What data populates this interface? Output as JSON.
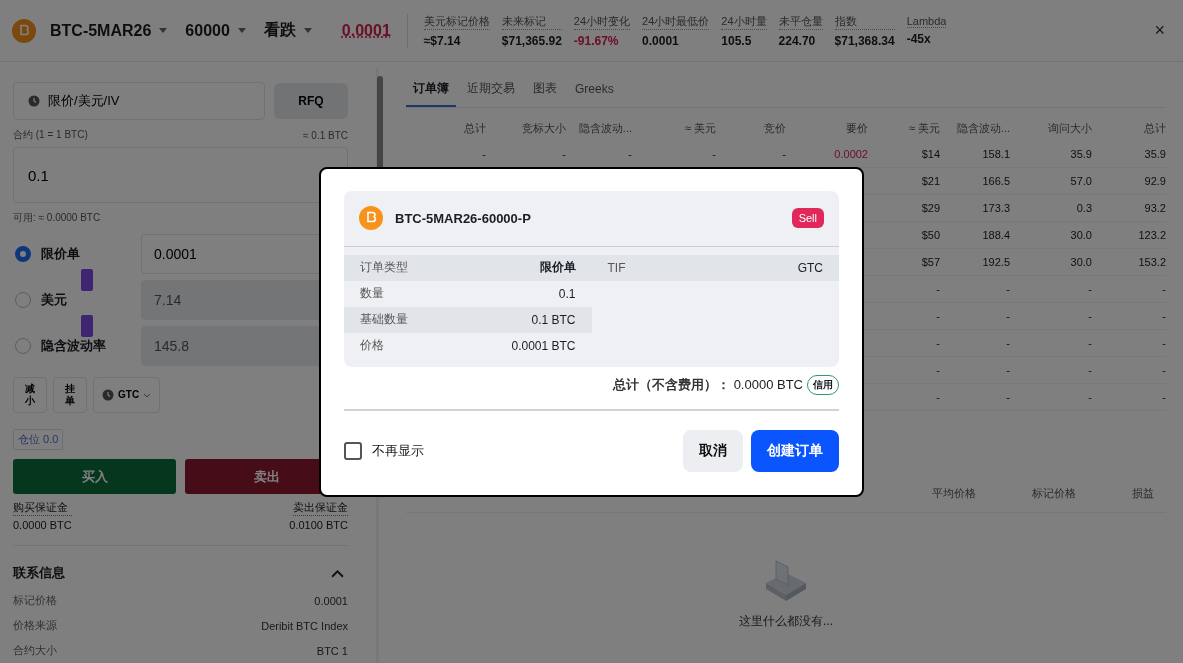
{
  "header": {
    "instrument": "BTC-5MAR26",
    "strike": "60000",
    "option_type": "看跌",
    "price": "0.0001",
    "close": "×",
    "stats": [
      {
        "label": "美元标记价格",
        "value": "≈$7.14",
        "negative": false
      },
      {
        "label": "未来标记",
        "value": "$71,365.92",
        "negative": false
      },
      {
        "label": "24小时变化",
        "value": "-91.67%",
        "negative": true
      },
      {
        "label": "24小时最低价",
        "value": "0.0001",
        "negative": false
      },
      {
        "label": "24小时量",
        "value": "105.5",
        "negative": false
      },
      {
        "label": "未平仓量",
        "value": "224.70",
        "negative": false
      },
      {
        "label": "指数",
        "value": "$71,368.34",
        "negative": false
      },
      {
        "label": "Lambda",
        "value": "-45x",
        "negative": false
      }
    ]
  },
  "order_form": {
    "order_type": "限价/美元/IV",
    "rfq": "RFQ",
    "contract_label": "合约 (1 = 1 BTC)",
    "contract_equiv": "≈ 0.1 BTC",
    "amount": "0.1",
    "available": "可用: ≈ 0.0000 BTC",
    "price_modes": [
      {
        "label": "限价单",
        "value": "0.0001",
        "selected": true,
        "tag": false
      },
      {
        "label": "美元",
        "value": "7.14",
        "selected": false,
        "tag": true
      },
      {
        "label": "隐含波动率",
        "value": "145.8",
        "selected": false,
        "tag": true
      }
    ],
    "options": [
      {
        "kind": "stacked",
        "chars": [
          "减",
          "小"
        ]
      },
      {
        "kind": "stacked",
        "chars": [
          "挂",
          "单"
        ]
      },
      {
        "kind": "select",
        "label": "GTC"
      }
    ],
    "position": "仓位 0.0",
    "buy": "买入",
    "sell": "卖出",
    "margins": [
      {
        "label": "购买保证金",
        "value": "0.0000 BTC"
      },
      {
        "label": "卖出保证金",
        "value": "0.0100 BTC"
      }
    ],
    "info": {
      "title": "联系信息",
      "expanded": true,
      "rows": [
        {
          "label": "标记价格",
          "value": "0.0001"
        },
        {
          "label": "价格来源",
          "value": "Deribit BTC Index"
        },
        {
          "label": "合约大小",
          "value": "BTC 1"
        }
      ]
    }
  },
  "market": {
    "tabs": [
      {
        "label": "订单簿",
        "selected": true
      },
      {
        "label": "近期交易",
        "selected": false
      },
      {
        "label": "图表",
        "selected": false
      },
      {
        "label": "Greeks",
        "selected": false
      }
    ],
    "columns": [
      "总计",
      "竞标大小",
      "隐含波动...",
      "≈ 美元",
      "竞价",
      "要价",
      "≈ 美元",
      "隐含波动...",
      "询问大小",
      "总计"
    ],
    "rows": [
      [
        "-",
        "-",
        "-",
        "-",
        "-",
        "0.0002",
        "$14",
        "158.1",
        "35.9",
        "35.9"
      ],
      [
        null,
        null,
        null,
        null,
        null,
        null,
        "$21",
        "166.5",
        "57.0",
        "92.9"
      ],
      [
        null,
        null,
        null,
        null,
        null,
        null,
        "$29",
        "173.3",
        "0.3",
        "93.2"
      ],
      [
        null,
        null,
        null,
        null,
        null,
        null,
        "$50",
        "188.4",
        "30.0",
        "123.2"
      ],
      [
        null,
        null,
        null,
        null,
        null,
        null,
        "$57",
        "192.5",
        "30.0",
        "153.2"
      ],
      [
        null,
        null,
        null,
        null,
        null,
        null,
        "-",
        "-",
        "-",
        "-"
      ],
      [
        null,
        null,
        null,
        null,
        null,
        null,
        "-",
        "-",
        "-",
        "-"
      ],
      [
        null,
        null,
        null,
        null,
        null,
        null,
        "-",
        "-",
        "-",
        "-"
      ],
      [
        null,
        null,
        null,
        null,
        null,
        null,
        "-",
        "-",
        "-",
        "-"
      ],
      [
        null,
        null,
        null,
        null,
        null,
        null,
        "-",
        "-",
        "-",
        "-"
      ]
    ],
    "positions_columns": [
      "平均价格",
      "标记价格",
      "损益"
    ],
    "empty_text": "这里什么都没有..."
  },
  "dialog": {
    "instrument": "BTC-5MAR26-60000-P",
    "side": "Sell",
    "left_rows": [
      {
        "label": "订单类型",
        "value": "限价单",
        "kind": "strong"
      },
      {
        "label": "数量",
        "value": "0.1",
        "kind": "plain"
      },
      {
        "label": "基础数量",
        "value": "0.1 BTC",
        "kind": "plain"
      },
      {
        "label": "价格",
        "value": "0.0001 BTC",
        "kind": "plain"
      }
    ],
    "right_rows": [
      {
        "label": "TIF",
        "value": "GTC"
      }
    ],
    "total_label": "总计（不含费用）：",
    "total_value": "0.0000 BTC",
    "total_badge": "信用",
    "dont_show": {
      "label": "不再显示",
      "checked": false
    },
    "cancel": "取消",
    "confirm": "创建订单"
  }
}
